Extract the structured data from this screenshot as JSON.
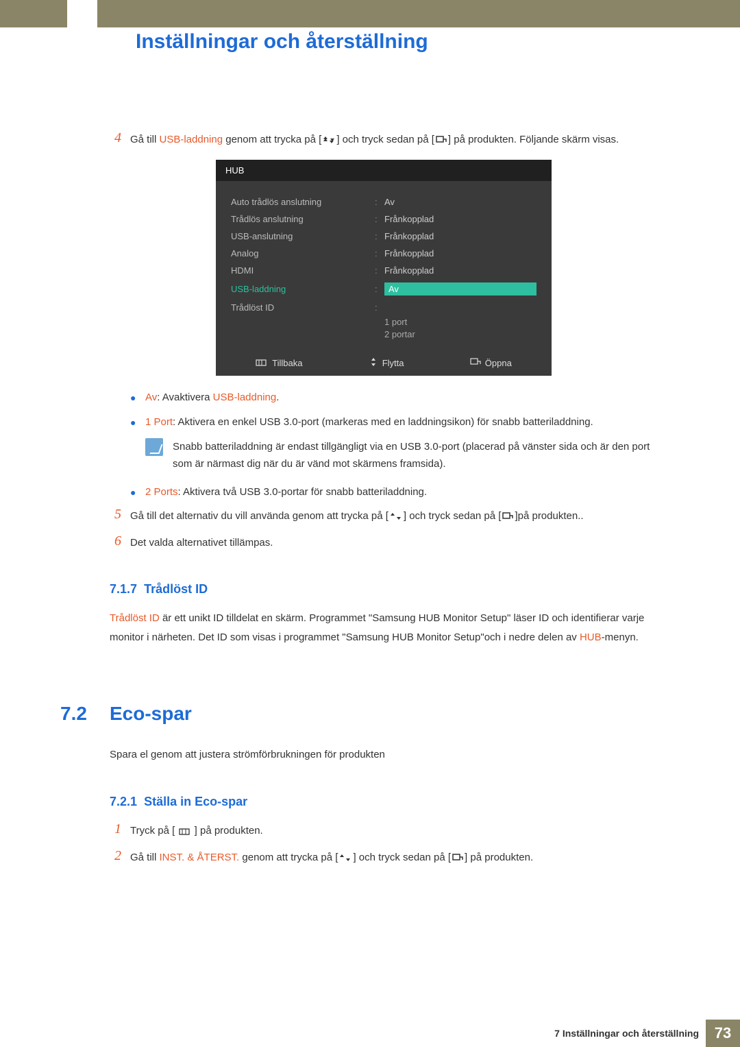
{
  "page_title": "Inställningar och återställning",
  "step4": {
    "num": "4",
    "text_pre": "Gå till ",
    "text_link": "USB-laddning",
    "text_mid1": " genom att trycka på [",
    "text_mid2": "] och tryck sedan på [",
    "text_post": "] på produkten. Följande skärm visas."
  },
  "hub": {
    "title": "HUB",
    "rows": [
      {
        "label": "Auto trådlös anslutning",
        "value": "Av"
      },
      {
        "label": "Trådlös anslutning",
        "value": "Frånkopplad"
      },
      {
        "label": "USB-anslutning",
        "value": "Frånkopplad"
      },
      {
        "label": "Analog",
        "value": "Frånkopplad"
      },
      {
        "label": "HDMI",
        "value": "Frånkopplad"
      }
    ],
    "active_row": {
      "label": "USB-laddning",
      "value": "Av"
    },
    "id_row": {
      "label": "Trådlöst ID"
    },
    "sub1": "1 port",
    "sub2": "2 portar",
    "footer": {
      "back": "Tillbaka",
      "move": "Flytta",
      "open": "Öppna"
    }
  },
  "bullets": {
    "av": {
      "label": "Av",
      "text1": ": Avaktivera ",
      "link": "USB-laddning",
      "text2": "."
    },
    "p1": {
      "label": "1 Port",
      "text": ": Aktivera en enkel USB 3.0-port (markeras med en laddningsikon) för snabb batteriladdning."
    },
    "p2": {
      "label": "2 Ports",
      "text": ": Aktivera två USB 3.0-portar för snabb batteriladdning."
    }
  },
  "note": "Snabb batteriladdning är endast tillgängligt via en USB 3.0-port (placerad på vänster sida och är den port som är närmast dig när du är vänd mot skärmens framsida).",
  "step5": {
    "num": "5",
    "text_pre": "Gå till det alternativ du vill använda genom att trycka på [",
    "text_mid": "] och tryck sedan på [",
    "text_post": "]på produkten.."
  },
  "step6": {
    "num": "6",
    "text": "Det valda alternativet tillämpas."
  },
  "sub717": {
    "num": "7.1.7",
    "title": "Trådlöst ID"
  },
  "tradlost_para": {
    "link1": "Trådlöst ID",
    "t1": " är ett unikt ID tilldelat en skärm. Programmet \"Samsung HUB Monitor Setup\" läser ID och identifierar varje monitor i närheten. Det ID som visas i programmet \"Samsung HUB Monitor Setup\"och i nedre delen av ",
    "link2": "HUB",
    "t2": "-menyn."
  },
  "sec72": {
    "num": "7.2",
    "title": "Eco-spar",
    "desc": "Spara el genom att justera strömförbrukningen för produkten"
  },
  "sub721": {
    "num": "7.2.1",
    "title": "Ställa in Eco-spar"
  },
  "eco_step1": {
    "num": "1",
    "pre": "Tryck på [ ",
    "post": " ] på produkten."
  },
  "eco_step2": {
    "num": "2",
    "pre": "Gå till ",
    "link": "INST. & ÅTERST.",
    "mid1": " genom att trycka på [",
    "mid2": "] och tryck sedan på [",
    "post": "] på produkten."
  },
  "footer": {
    "chapter": "7 Inställningar och återställning",
    "page": "73"
  }
}
